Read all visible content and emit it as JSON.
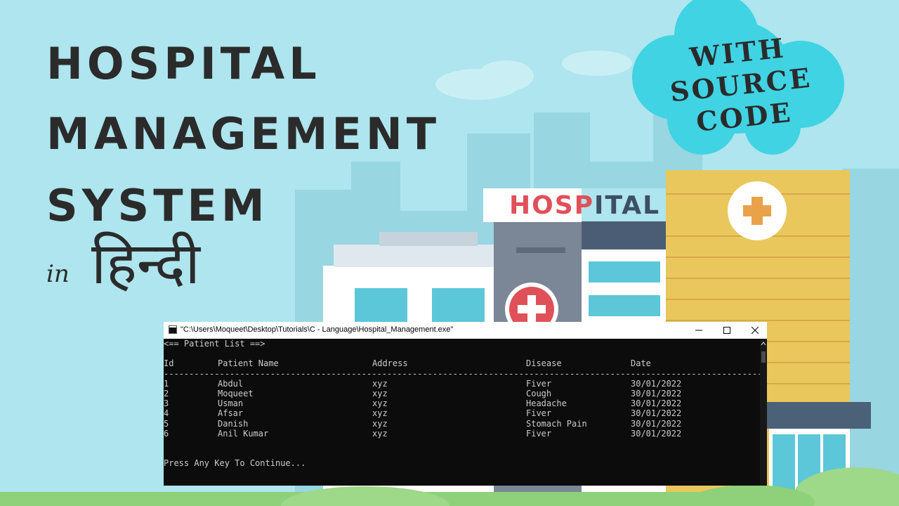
{
  "thumbnail": {
    "title_lines": [
      "HOSPITAL",
      "MANAGEMENT",
      "SYSTEM"
    ],
    "in_word": "in",
    "language_word": "हिन्दी",
    "badge_lines": [
      "WITH",
      "SOURCE",
      "CODE"
    ],
    "building_sign": {
      "highlight": "HOSP",
      "rest": "ITAL"
    }
  },
  "window": {
    "title": "\"C:\\Users\\Moqueet\\Desktop\\Tutorials\\C - Language\\Hospital_Management.exe\"",
    "controls": [
      "minimize-icon",
      "maximize-icon",
      "close-icon"
    ]
  },
  "console": {
    "heading": "<== Patient List ==>",
    "columns": [
      "Id",
      "Patient Name",
      "Address",
      "Disease",
      "Date"
    ],
    "separator": "-----------------------------------------------------------------------------------------------------------------------------------------------",
    "rows": [
      [
        "1",
        "Abdul",
        "xyz",
        "Fiver",
        "30/01/2022"
      ],
      [
        "2",
        "Moqueet",
        "xyz",
        "Cough",
        "30/01/2022"
      ],
      [
        "3",
        "Usman",
        "xyz",
        "Headache",
        "30/01/2022"
      ],
      [
        "4",
        "Afsar",
        "xyz",
        "Fiver",
        "30/01/2022"
      ],
      [
        "5",
        "Danish",
        "xyz",
        "Stomach Pain",
        "30/01/2022"
      ],
      [
        "6",
        "Anil Kumar",
        "xyz",
        "Fiver",
        "30/01/2022"
      ]
    ],
    "prompt": "Press Any Key To Continue..."
  },
  "colors": {
    "background": "#aee5ee",
    "title_text": "#2b2b2b",
    "badge_cloud": "#3fd3e3",
    "building_yellow": "#e9c75c",
    "sign_red": "#e05058",
    "console_bg": "#0c0c0c",
    "console_text": "#cccccc"
  }
}
